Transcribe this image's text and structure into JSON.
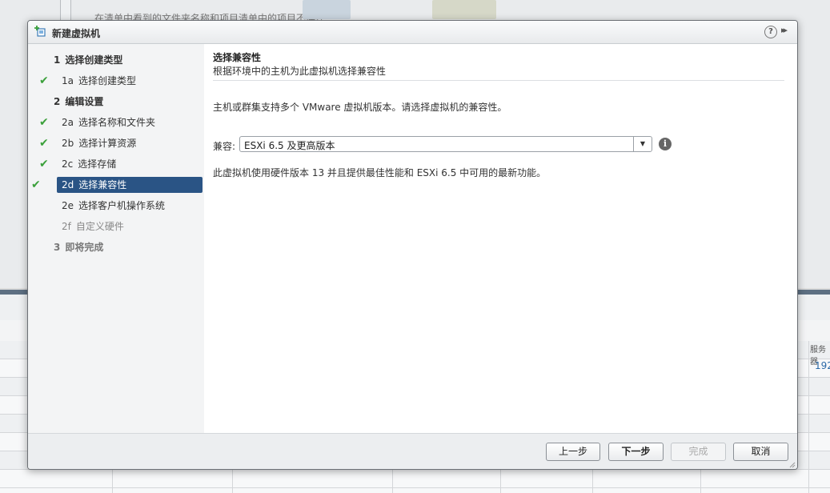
{
  "background": {
    "top_text": "在清单中看到的文件夹名称和项目清单中的项目不存在",
    "table_header": "服务器",
    "table_cell": "192"
  },
  "dialog": {
    "title": "新建虚拟机",
    "help": "?",
    "collapse": "▸▸"
  },
  "steps": [
    {
      "num": "1",
      "label": "选择创建类型",
      "level": "main",
      "done": false
    },
    {
      "num": "1a",
      "label": "选择创建类型",
      "level": "sub",
      "done": true
    },
    {
      "num": "2",
      "label": "编辑设置",
      "level": "main",
      "done": false
    },
    {
      "num": "2a",
      "label": "选择名称和文件夹",
      "level": "sub",
      "done": true
    },
    {
      "num": "2b",
      "label": "选择计算资源",
      "level": "sub",
      "done": true
    },
    {
      "num": "2c",
      "label": "选择存储",
      "level": "sub",
      "done": true
    },
    {
      "num": "2d",
      "label": "选择兼容性",
      "level": "sub",
      "done": true,
      "active": true
    },
    {
      "num": "2e",
      "label": "选择客户机操作系统",
      "level": "sub",
      "done": false
    },
    {
      "num": "2f",
      "label": "自定义硬件",
      "level": "sub",
      "done": false,
      "disabled": true
    },
    {
      "num": "3",
      "label": "即将完成",
      "level": "main",
      "done": false,
      "disabled": true
    }
  ],
  "content": {
    "heading": "选择兼容性",
    "subheading": "根据环境中的主机为此虚拟机选择兼容性",
    "description": "主机或群集支持多个 VMware 虚拟机版本。请选择虚拟机的兼容性。",
    "compat_label": "兼容:",
    "compat_value": "ESXi 6.5 及更高版本",
    "compat_note": "此虚拟机使用硬件版本 13 并且提供最佳性能和 ESXi 6.5 中可用的最新功能。"
  },
  "footer": {
    "back": "上一步",
    "next": "下一步",
    "finish": "完成",
    "cancel": "取消"
  },
  "colors": {
    "active_step": "#2a5485",
    "check": "#3ba03b",
    "border": "#6c7075"
  }
}
